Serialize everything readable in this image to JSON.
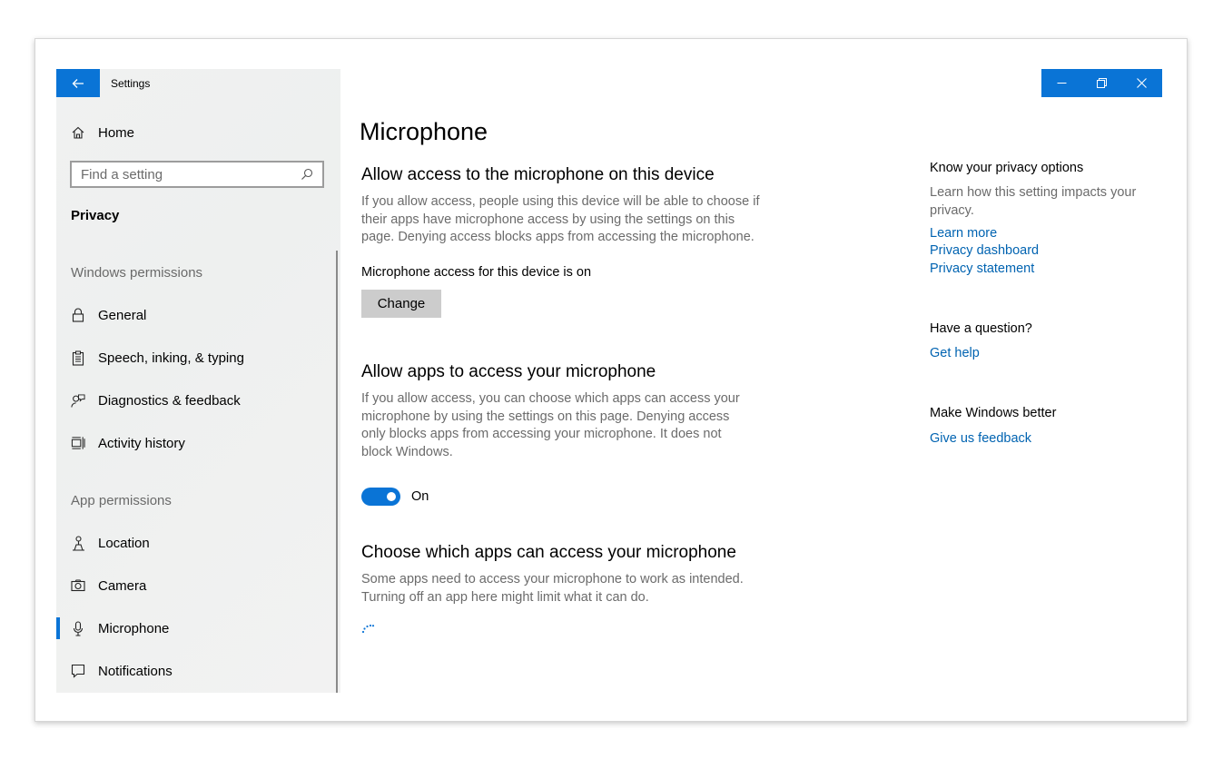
{
  "window": {
    "app_title": "Settings",
    "colors": {
      "accent": "#0a74d6",
      "link": "#0063b1",
      "sidebar_bg": "#f0f1f1",
      "button_bg": "#cccccc"
    }
  },
  "sidebar": {
    "home_label": "Home",
    "search": {
      "placeholder": "Find a setting"
    },
    "section_title": "Privacy",
    "groups": [
      {
        "label": "Windows permissions",
        "items": [
          {
            "label": "General",
            "icon": "lock-icon"
          },
          {
            "label": "Speech, inking, & typing",
            "icon": "clipboard-icon"
          },
          {
            "label": "Diagnostics & feedback",
            "icon": "person-feedback-icon"
          },
          {
            "label": "Activity history",
            "icon": "timeline-icon"
          }
        ]
      },
      {
        "label": "App permissions",
        "items": [
          {
            "label": "Location",
            "icon": "location-person-icon"
          },
          {
            "label": "Camera",
            "icon": "camera-icon"
          },
          {
            "label": "Microphone",
            "icon": "microphone-icon",
            "selected": true
          },
          {
            "label": "Notifications",
            "icon": "chat-bubble-icon"
          }
        ]
      }
    ]
  },
  "main": {
    "title": "Microphone",
    "device_access": {
      "heading": "Allow access to the microphone on this device",
      "description": "If you allow access, people using this device will be able to choose if their apps have microphone access by using the settings on this page. Denying access blocks apps from accessing the microphone.",
      "status": "Microphone access for this device is on",
      "button_label": "Change"
    },
    "app_access": {
      "heading": "Allow apps to access your microphone",
      "description": "If you allow access, you can choose which apps can access your microphone by using the settings on this page. Denying access only blocks apps from accessing your microphone. It does not block Windows.",
      "toggle_state": "On"
    },
    "choose_apps": {
      "heading": "Choose which apps can access your microphone",
      "description": "Some apps need to access your microphone to work as intended. Turning off an app here might limit what it can do."
    }
  },
  "right": {
    "privacy_options": {
      "heading": "Know your privacy options",
      "description": "Learn how this setting impacts your privacy.",
      "links": [
        "Learn more",
        "Privacy dashboard",
        "Privacy statement"
      ]
    },
    "question": {
      "heading": "Have a question?",
      "link": "Get help"
    },
    "better": {
      "heading": "Make Windows better",
      "link": "Give us feedback"
    }
  }
}
